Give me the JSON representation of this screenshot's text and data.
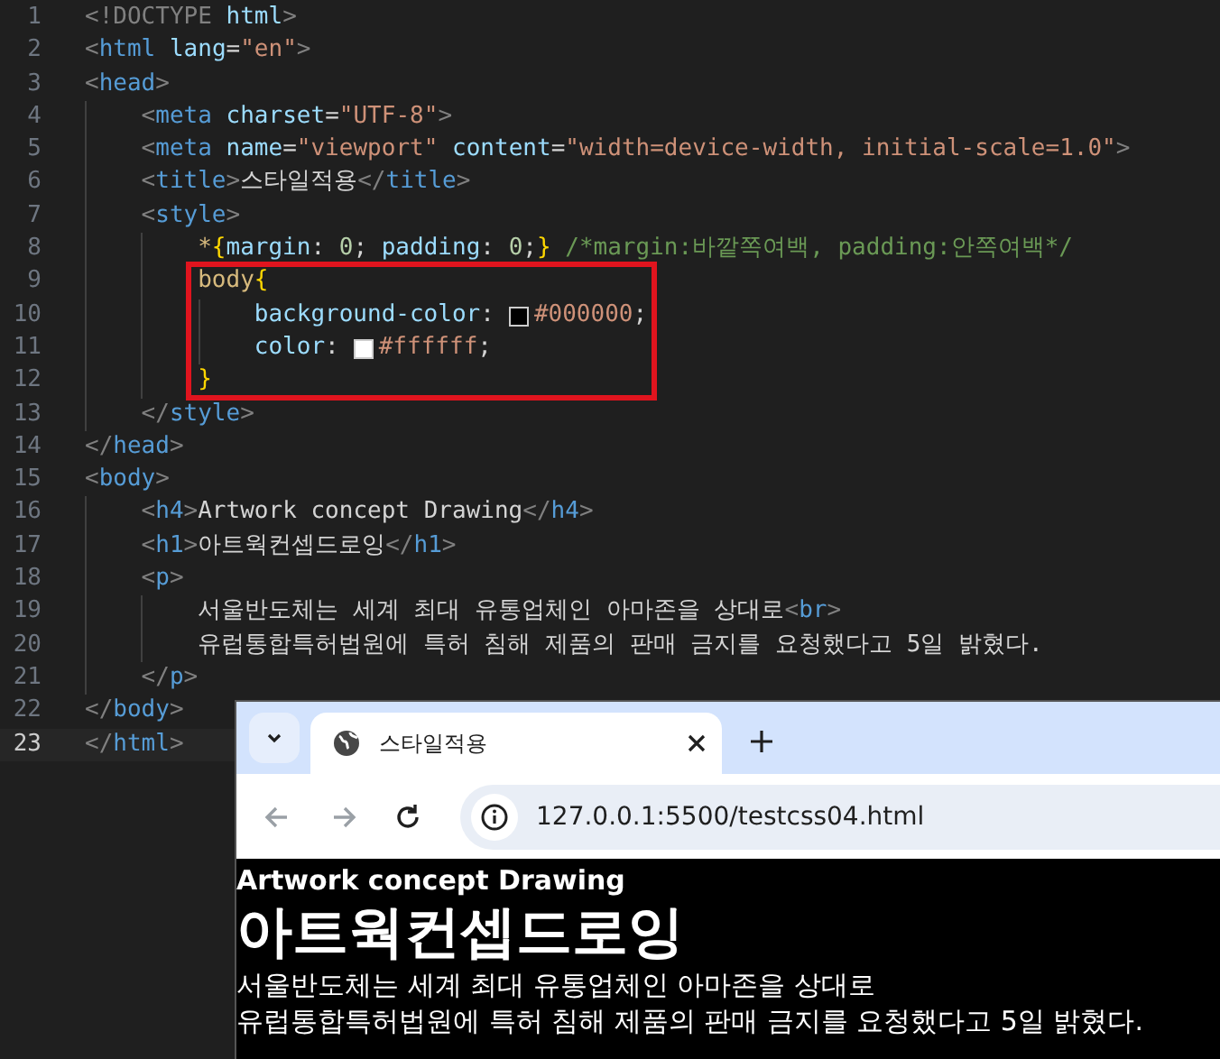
{
  "editor": {
    "blocks": [
      {
        "highlighted": false,
        "lines": [
          {
            "number": "1",
            "selected": false,
            "tokens": [
              {
                "kind": "punct",
                "text": "<!DOCTYPE"
              },
              {
                "kind": "attr",
                "text": " html"
              },
              {
                "kind": "punct",
                "text": ">"
              }
            ]
          },
          {
            "number": "2",
            "selected": false,
            "tokens": [
              {
                "kind": "punct",
                "text": "<"
              },
              {
                "kind": "tag",
                "text": "html"
              },
              {
                "kind": "attr",
                "text": " lang"
              },
              {
                "kind": "plain",
                "text": "="
              },
              {
                "kind": "string",
                "text": "\"en\""
              },
              {
                "kind": "punct",
                "text": ">"
              }
            ]
          },
          {
            "number": "3",
            "selected": false,
            "tokens": [
              {
                "kind": "punct",
                "text": "<"
              },
              {
                "kind": "tag",
                "text": "head"
              },
              {
                "kind": "punct",
                "text": ">"
              }
            ]
          },
          {
            "number": "4",
            "selected": false,
            "tokens": [
              {
                "kind": "punct",
                "text": "    <"
              },
              {
                "kind": "tag",
                "text": "meta"
              },
              {
                "kind": "attr",
                "text": " charset"
              },
              {
                "kind": "plain",
                "text": "="
              },
              {
                "kind": "string",
                "text": "\"UTF-8\""
              },
              {
                "kind": "punct",
                "text": ">"
              }
            ]
          },
          {
            "number": "5",
            "selected": false,
            "tokens": [
              {
                "kind": "punct",
                "text": "    <"
              },
              {
                "kind": "tag",
                "text": "meta"
              },
              {
                "kind": "attr",
                "text": " name"
              },
              {
                "kind": "plain",
                "text": "="
              },
              {
                "kind": "string",
                "text": "\"viewport\""
              },
              {
                "kind": "attr",
                "text": " content"
              },
              {
                "kind": "plain",
                "text": "="
              },
              {
                "kind": "string",
                "text": "\"width=device-width, initial-scale=1.0\""
              },
              {
                "kind": "punct",
                "text": ">"
              }
            ]
          },
          {
            "number": "6",
            "selected": false,
            "tokens": [
              {
                "kind": "punct",
                "text": "    <"
              },
              {
                "kind": "tag",
                "text": "title"
              },
              {
                "kind": "punct",
                "text": ">"
              },
              {
                "kind": "plain",
                "text": "스타일적용"
              },
              {
                "kind": "punct",
                "text": "</"
              },
              {
                "kind": "tag",
                "text": "title"
              },
              {
                "kind": "punct",
                "text": ">"
              }
            ]
          },
          {
            "number": "7",
            "selected": false,
            "tokens": [
              {
                "kind": "punct",
                "text": "    <"
              },
              {
                "kind": "tag",
                "text": "style"
              },
              {
                "kind": "punct",
                "text": ">"
              }
            ]
          },
          {
            "number": "8",
            "selected": false,
            "tokens": [
              {
                "kind": "selector",
                "text": "        *"
              },
              {
                "kind": "brace",
                "text": "{"
              },
              {
                "kind": "attr",
                "text": "margin"
              },
              {
                "kind": "plain",
                "text": ":"
              },
              {
                "kind": "number",
                "text": " 0"
              },
              {
                "kind": "plain",
                "text": ";"
              },
              {
                "kind": "attr",
                "text": " padding"
              },
              {
                "kind": "plain",
                "text": ":"
              },
              {
                "kind": "number",
                "text": " 0"
              },
              {
                "kind": "plain",
                "text": ";"
              },
              {
                "kind": "brace",
                "text": "}"
              },
              {
                "kind": "comment",
                "text": " /*margin:바깥쪽여백, padding:안쪽여백*/"
              }
            ]
          }
        ]
      },
      {
        "highlighted": true,
        "lines": [
          {
            "number": "9",
            "selected": false,
            "tokens": [
              {
                "kind": "selector",
                "text": "        body"
              },
              {
                "kind": "brace",
                "text": "{"
              }
            ]
          },
          {
            "number": "10",
            "selected": false,
            "tokens": [
              {
                "kind": "attr",
                "text": "            background-color"
              },
              {
                "kind": "plain",
                "text": ":"
              },
              {
                "kind": "swatch",
                "color": "#000000"
              },
              {
                "kind": "string",
                "text": "#000000"
              },
              {
                "kind": "plain",
                "text": ";"
              }
            ]
          },
          {
            "number": "11",
            "selected": false,
            "tokens": [
              {
                "kind": "attr",
                "text": "            color"
              },
              {
                "kind": "plain",
                "text": ":"
              },
              {
                "kind": "swatch",
                "color": "#ffffff"
              },
              {
                "kind": "string",
                "text": "#ffffff"
              },
              {
                "kind": "plain",
                "text": ";"
              }
            ]
          },
          {
            "number": "12",
            "selected": false,
            "tokens": [
              {
                "kind": "brace",
                "text": "        }"
              }
            ]
          }
        ]
      },
      {
        "highlighted": false,
        "lines": [
          {
            "number": "13",
            "selected": false,
            "tokens": [
              {
                "kind": "punct",
                "text": "    </"
              },
              {
                "kind": "tag",
                "text": "style"
              },
              {
                "kind": "punct",
                "text": ">"
              }
            ]
          },
          {
            "number": "14",
            "selected": false,
            "tokens": [
              {
                "kind": "punct",
                "text": "</"
              },
              {
                "kind": "tag",
                "text": "head"
              },
              {
                "kind": "punct",
                "text": ">"
              }
            ]
          },
          {
            "number": "15",
            "selected": false,
            "tokens": [
              {
                "kind": "punct",
                "text": "<"
              },
              {
                "kind": "tag",
                "text": "body"
              },
              {
                "kind": "punct",
                "text": ">"
              }
            ]
          },
          {
            "number": "16",
            "selected": false,
            "tokens": [
              {
                "kind": "punct",
                "text": "    <"
              },
              {
                "kind": "tag",
                "text": "h4"
              },
              {
                "kind": "punct",
                "text": ">"
              },
              {
                "kind": "plain",
                "text": "Artwork concept Drawing"
              },
              {
                "kind": "punct",
                "text": "</"
              },
              {
                "kind": "tag",
                "text": "h4"
              },
              {
                "kind": "punct",
                "text": ">"
              }
            ]
          },
          {
            "number": "17",
            "selected": false,
            "tokens": [
              {
                "kind": "punct",
                "text": "    <"
              },
              {
                "kind": "tag",
                "text": "h1"
              },
              {
                "kind": "punct",
                "text": ">"
              },
              {
                "kind": "plain",
                "text": "아트웍컨셉드로잉"
              },
              {
                "kind": "punct",
                "text": "</"
              },
              {
                "kind": "tag",
                "text": "h1"
              },
              {
                "kind": "punct",
                "text": ">"
              }
            ]
          },
          {
            "number": "18",
            "selected": false,
            "tokens": [
              {
                "kind": "punct",
                "text": "    <"
              },
              {
                "kind": "tag",
                "text": "p"
              },
              {
                "kind": "punct",
                "text": ">"
              }
            ]
          },
          {
            "number": "19",
            "selected": false,
            "tokens": [
              {
                "kind": "plain",
                "text": "        서울반도체는 세계 최대 유통업체인 아마존을 상대로"
              },
              {
                "kind": "punct",
                "text": "<"
              },
              {
                "kind": "tag",
                "text": "br"
              },
              {
                "kind": "punct",
                "text": ">"
              }
            ]
          },
          {
            "number": "20",
            "selected": false,
            "tokens": [
              {
                "kind": "plain",
                "text": "        유럽통합특허법원에 특허 침해 제품의 판매 금지를 요청했다고 5일 밝혔다."
              }
            ]
          },
          {
            "number": "21",
            "selected": false,
            "tokens": [
              {
                "kind": "punct",
                "text": "    </"
              },
              {
                "kind": "tag",
                "text": "p"
              },
              {
                "kind": "punct",
                "text": ">"
              }
            ]
          },
          {
            "number": "22",
            "selected": false,
            "tokens": [
              {
                "kind": "punct",
                "text": "</"
              },
              {
                "kind": "tag",
                "text": "body"
              },
              {
                "kind": "punct",
                "text": ">"
              }
            ]
          },
          {
            "number": "23",
            "selected": true,
            "tokens": [
              {
                "kind": "punct",
                "text": "</"
              },
              {
                "kind": "tag",
                "text": "html"
              },
              {
                "kind": "punct",
                "text": ">"
              }
            ]
          }
        ]
      }
    ]
  },
  "browser": {
    "tab": {
      "title": "스타일적용"
    },
    "nav": [
      {
        "kind": "back",
        "disabled": true
      },
      {
        "kind": "forward",
        "disabled": true
      },
      {
        "kind": "reload",
        "disabled": false
      }
    ],
    "address": "127.0.0.1:5500/testcss04.html",
    "page": {
      "h4": "Artwork concept Drawing",
      "h1": "아트웍컨셉드로잉",
      "paragraph_lines": [
        "서울반도체는 세계 최대 유통업체인 아마존을 상대로",
        "유럽통합특허법원에 특허 침해 제품의 판매 금지를 요청했다고 5일 밝혔다."
      ]
    }
  }
}
